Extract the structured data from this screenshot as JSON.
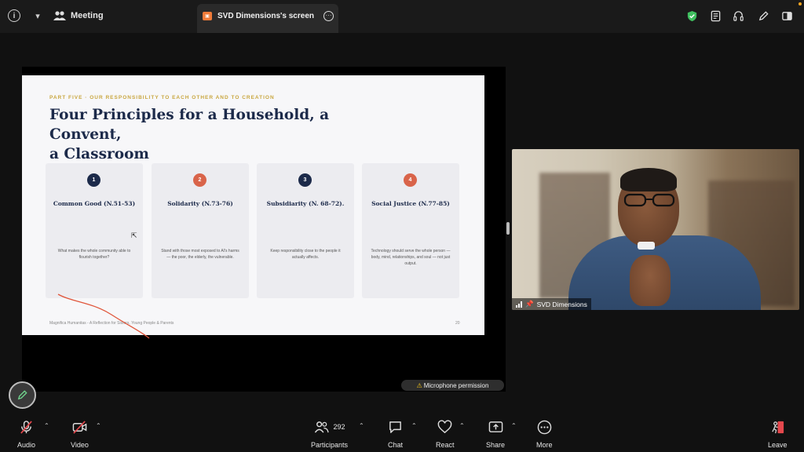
{
  "topbar": {
    "info_icon": "info-icon",
    "chevron": "chevron-down-icon",
    "meeting_label": "Meeting",
    "screen_tab_label": "SVD Dimensions's screen",
    "right_icons": [
      "shield-check-icon",
      "notes-icon",
      "headset-icon",
      "pencil-icon",
      "sidebar-icon"
    ]
  },
  "slide": {
    "kicker": "PART FIVE · OUR RESPONSIBILITY TO EACH OTHER AND TO CREATION",
    "title_line1": "Four Principles for a Household, a Convent,",
    "title_line2": "a Classroom",
    "cards": [
      {
        "num": "1",
        "title": "Common Good (N.51-53)",
        "body": "What makes the whole community able to flourish together?",
        "color": "#1c2a4a"
      },
      {
        "num": "2",
        "title": "Solidarity (N.73-76)",
        "body": "Stand with those most exposed to AI's harms — the poor, the elderly, the vulnerable.",
        "color": "#d9644a"
      },
      {
        "num": "3",
        "title": "Subsidiarity (N. 68-72).",
        "body": "Keep responsibility close to the people it actually affects.",
        "color": "#1c2a4a"
      },
      {
        "num": "4",
        "title": "Social Justice (N.77-85)",
        "body": "Technology should serve the whole person — body, mind, relationships, and soul — not just output.",
        "color": "#d9644a"
      }
    ],
    "footer": "Magnifica Humanitas - A Reflection for Sisters, Young People & Parents",
    "page": "20"
  },
  "notice": {
    "microphone_permission": "Microphone permission"
  },
  "video": {
    "participant_name": "SVD Dimensions"
  },
  "toolbar": {
    "audio": "Audio",
    "video": "Video",
    "participants": "Participants",
    "participants_count": "292",
    "chat": "Chat",
    "react": "React",
    "share": "Share",
    "more": "More",
    "leave": "Leave"
  }
}
